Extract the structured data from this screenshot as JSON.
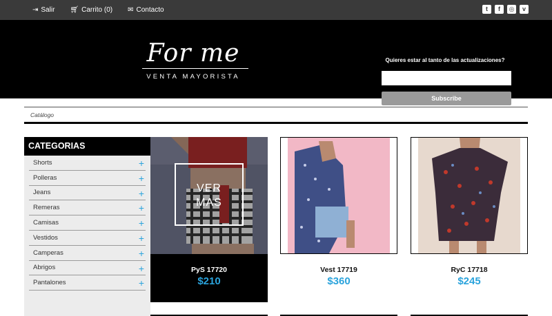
{
  "topnav": {
    "logout": {
      "icon": "sign-out-icon",
      "label": "Salir"
    },
    "cart": {
      "icon": "cart-icon",
      "label": "Carrito (0)"
    },
    "contact": {
      "icon": "envelope-icon",
      "label": "Contacto"
    }
  },
  "social": [
    "twitter-icon",
    "facebook-icon",
    "instagram-icon",
    "vimeo-icon"
  ],
  "logo": {
    "script": "For me",
    "tagline": "VENTA MAYORISTA"
  },
  "newsletter": {
    "question": "Quieres estar al tanto de las actualizaciones?",
    "email_value": "",
    "button": "Subscribe"
  },
  "breadcrumb": "Catálogo",
  "sidebar": {
    "title": "CATEGORIAS",
    "items": [
      {
        "label": "Shorts"
      },
      {
        "label": "Polleras"
      },
      {
        "label": "Jeans"
      },
      {
        "label": "Remeras"
      },
      {
        "label": "Camisas"
      },
      {
        "label": "Vestidos"
      },
      {
        "label": "Camperas"
      },
      {
        "label": "Abrigos"
      },
      {
        "label": "Pantalones"
      }
    ]
  },
  "products": [
    {
      "name": "PyS 17720",
      "price": "$210",
      "overlay_line1": "VER",
      "overlay_line2": "MAS"
    },
    {
      "name": "Vest 17719",
      "price": "$360"
    },
    {
      "name": "RyC 17718",
      "price": "$245"
    }
  ],
  "colors": {
    "accent": "#2aa3dc",
    "topbar": "#3a3a3a",
    "header": "#000000"
  }
}
